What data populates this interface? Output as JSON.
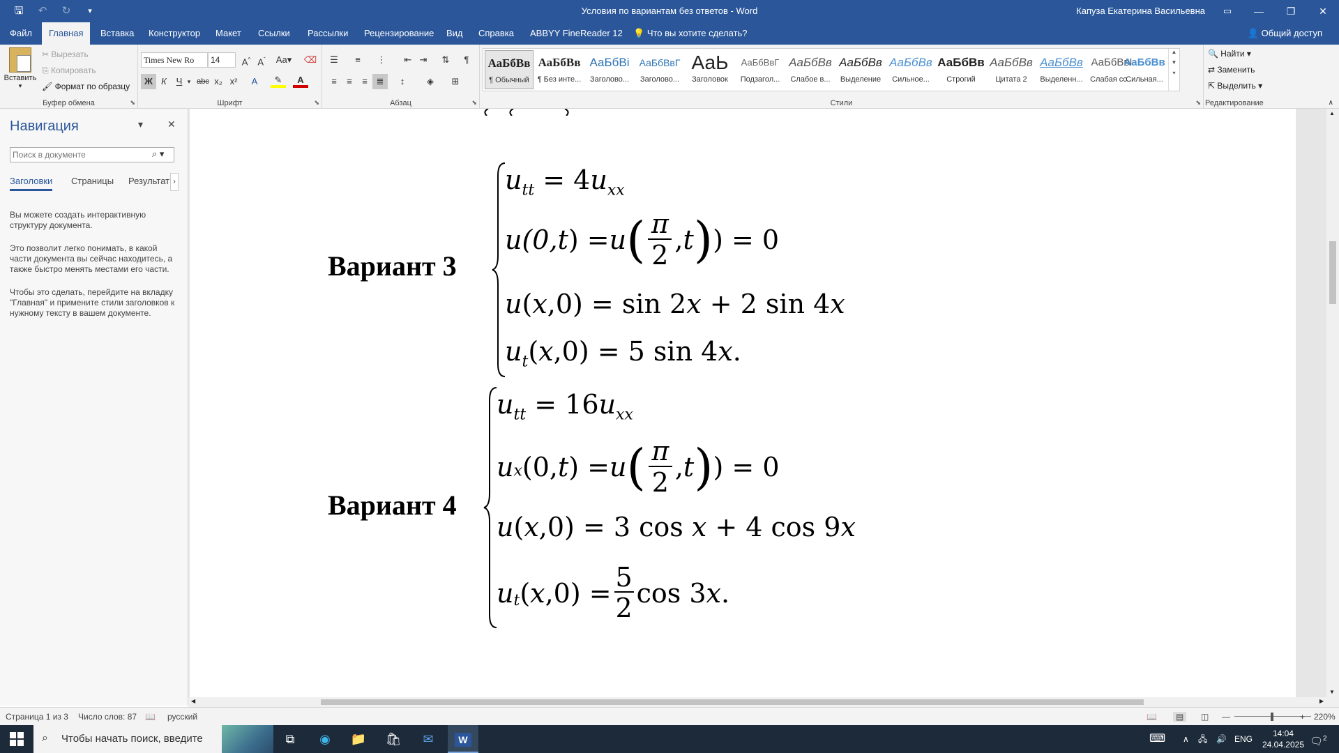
{
  "app": {
    "title": "Условия по вариантам без ответов  -  Word",
    "user": "Капуза Екатерина Васильевна"
  },
  "tabs": [
    "Файл",
    "Главная",
    "Вставка",
    "Конструктор",
    "Макет",
    "Ссылки",
    "Рассылки",
    "Рецензирование",
    "Вид",
    "Справка",
    "ABBYY FineReader 12",
    "Что вы хотите сделать?"
  ],
  "share": "Общий доступ",
  "ribbon": {
    "clipboard": {
      "paste": "Вставить",
      "cut": "Вырезать",
      "copy": "Копировать",
      "format_painter": "Формат по образцу",
      "label": "Буфер обмена"
    },
    "font": {
      "name": "Times New Ro",
      "size": "14",
      "case_btn": "Aa",
      "bold": "Ж",
      "italic": "К",
      "underline": "Ч",
      "strike": "abc",
      "subscript": "x₂",
      "superscript": "x²",
      "label": "Шрифт"
    },
    "paragraph": {
      "label": "Абзац"
    },
    "styles": {
      "items": [
        {
          "preview": "АаБбВв",
          "name": "¶ Обычный"
        },
        {
          "preview": "АаБбВв",
          "name": "¶ Без инте..."
        },
        {
          "preview": "АаБбВі",
          "name": "Заголово..."
        },
        {
          "preview": "АаБбВвГ",
          "name": "Заголово..."
        },
        {
          "preview": "АаЬ",
          "name": "Заголовок"
        },
        {
          "preview": "АаБбВвГ",
          "name": "Подзагол..."
        },
        {
          "preview": "АаБбВв",
          "name": "Слабое в..."
        },
        {
          "preview": "АаБбВв",
          "name": "Выделение"
        },
        {
          "preview": "АаБбВв",
          "name": "Сильное..."
        },
        {
          "preview": "АаБбВв",
          "name": "Строгий"
        },
        {
          "preview": "АаБбВв",
          "name": "Цитата 2"
        },
        {
          "preview": "АаБбВв",
          "name": "Выделенн..."
        },
        {
          "preview": "АаБбВвІ",
          "name": "Слабая сс..."
        },
        {
          "preview": "АаБбВв",
          "name": "Сильная..."
        }
      ],
      "label": "Стили"
    },
    "editing": {
      "find": "Найти",
      "replace": "Заменить",
      "select": "Выделить",
      "label": "Редактирование"
    }
  },
  "nav": {
    "title": "Навигация",
    "search_placeholder": "Поиск в документе",
    "tabs": [
      "Заголовки",
      "Страницы",
      "Результаты"
    ],
    "help": [
      "Вы можете создать интерактивную структуру документа.",
      "Это позволит легко понимать, в какой части документа вы сейчас находитесь, а также быстро менять местами его части.",
      "Чтобы это сделать, перейдите на вкладку \"Главная\" и примените стили заголовков к нужному тексту в вашем документе."
    ]
  },
  "document": {
    "variants": [
      {
        "label": "Вариант 3",
        "equations": [
          "u_tt = 4u_xx",
          "u(0,t) = u(π/2, t) = 0",
          "u(x,0) = sin 2x + 2 sin 4x",
          "u_t(x,0) = 5 sin 4x."
        ],
        "parts": {
          "e1": {
            "a": "u",
            "as": "tt",
            "b": " = 4",
            "c": "u",
            "cs": "xx"
          },
          "e2": {
            "a": "u(0,",
            "t": "t",
            "b": ") = ",
            "c": "u",
            "num": "π",
            "den": "2",
            "d": ",",
            "t2": "t",
            "e": ") = 0"
          },
          "e3": {
            "a": "u",
            "b": "(",
            "x": "x",
            "c": ",0) = sin 2",
            "x2": "x",
            "d": " + 2 sin 4",
            "x3": "x"
          },
          "e4": {
            "a": "u",
            "as": "t",
            "b": "(",
            "x": "x",
            "c": ",0) = 5 sin 4",
            "x2": "x",
            "d": "."
          }
        }
      },
      {
        "label": "Вариант 4",
        "equations": [
          "u_tt = 16u_xx",
          "u_x(0,t) = u(π/2, t) = 0",
          "u(x,0) = 3 cos x + 4 cos 9x",
          "u_t(x,0) = 5/2 cos 3x."
        ],
        "parts": {
          "e1": {
            "a": "u",
            "as": "tt",
            "b": " = 16",
            "c": "u",
            "cs": "xx"
          },
          "e2": {
            "a": "u",
            "as": "x",
            "b": "(0,",
            "t": "t",
            "c": ") = ",
            "d": "u",
            "num": "π",
            "den": "2",
            "e": ",",
            "t2": "t",
            "f": ") = 0"
          },
          "e3": {
            "a": "u",
            "b": "(",
            "x": "x",
            "c": ",0) = 3 cos ",
            "x2": "x",
            "d": " + 4 cos 9",
            "x3": "x"
          },
          "e4": {
            "a": "u",
            "as": "t",
            "b": "(",
            "x": "x",
            "c": ",0) = ",
            "num": "5",
            "den": "2",
            "d": "cos 3",
            "x2": "x",
            "e": "."
          }
        }
      }
    ]
  },
  "status": {
    "page": "Страница 1 из 3",
    "words": "Число слов: 87",
    "language": "русский",
    "zoom": "220%"
  },
  "taskbar": {
    "search_placeholder": "Чтобы начать поиск, введите",
    "lang": "ENG",
    "time": "14:04",
    "date": "24.04.2025",
    "notifications": "2"
  }
}
